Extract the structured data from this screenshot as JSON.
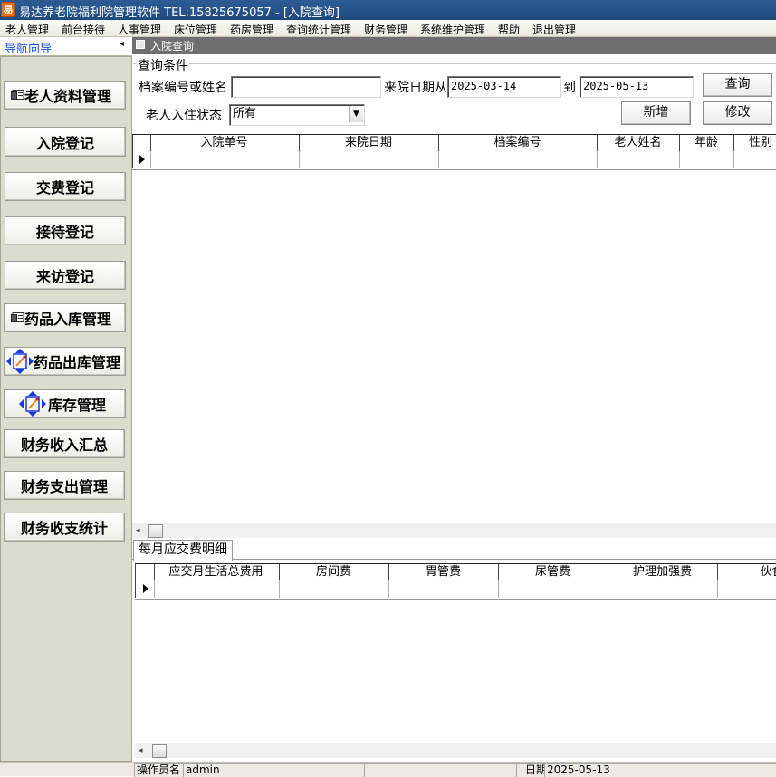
{
  "window": {
    "app_icon_text": "易",
    "title": "易达养老院福利院管理软件  TEL:15825675057  - [入院查询]"
  },
  "menu": [
    "老人管理",
    "前台接待",
    "人事管理",
    "床位管理",
    "药房管理",
    "查询统计管理",
    "财务管理",
    "系统维护管理",
    "帮助",
    "退出管理"
  ],
  "nav": {
    "title": "导航向导",
    "collapse_glyph": "◂",
    "buttons": [
      {
        "label": "老人资料管理",
        "icon": "card-icon"
      },
      {
        "label": "入院登记",
        "icon": ""
      },
      {
        "label": "交费登记",
        "icon": ""
      },
      {
        "label": "接待登记",
        "icon": ""
      },
      {
        "label": "来访登记",
        "icon": ""
      },
      {
        "label": "药品入库管理",
        "icon": "card-icon"
      },
      {
        "label": "药品出库管理",
        "icon": "box-arrows-icon"
      },
      {
        "label": "库存管理",
        "icon": "box-arrows-icon"
      },
      {
        "label": "财务收入汇总",
        "icon": ""
      },
      {
        "label": "财务支出管理",
        "icon": ""
      },
      {
        "label": "财务收支统计",
        "icon": ""
      }
    ]
  },
  "content": {
    "title": "入院查询",
    "query": {
      "group_title": "查询条件",
      "id_or_name_label": "档案编号或姓名",
      "id_or_name_value": "",
      "date_from_label": "来院日期从",
      "date_from": "2025-03-14",
      "date_to_label": "到",
      "date_to": "2025-05-13",
      "status_label": "老人入住状态",
      "status_value": "所有",
      "search_button": "查询",
      "add_button": "新增",
      "edit_button": "修改"
    },
    "admission_grid": {
      "columns": [
        "入院单号",
        "来院日期",
        "档案编号",
        "老人姓名",
        "年龄",
        "性别"
      ]
    },
    "tab": "每月应交费明细",
    "fee_grid": {
      "columns": [
        "应交月生活总费用",
        "房间费",
        "胃管费",
        "尿管费",
        "护理加强费",
        "伙食"
      ]
    }
  },
  "status": {
    "operator_label": "操作员名",
    "operator": "admin",
    "date_label": "日期",
    "date": "2025-05-13"
  },
  "colors": {
    "titlebar": "#1f4a80",
    "nav_panel": "#dadccd",
    "content_header": "#6f6f6f",
    "nav_title": "#1a4ed8"
  }
}
